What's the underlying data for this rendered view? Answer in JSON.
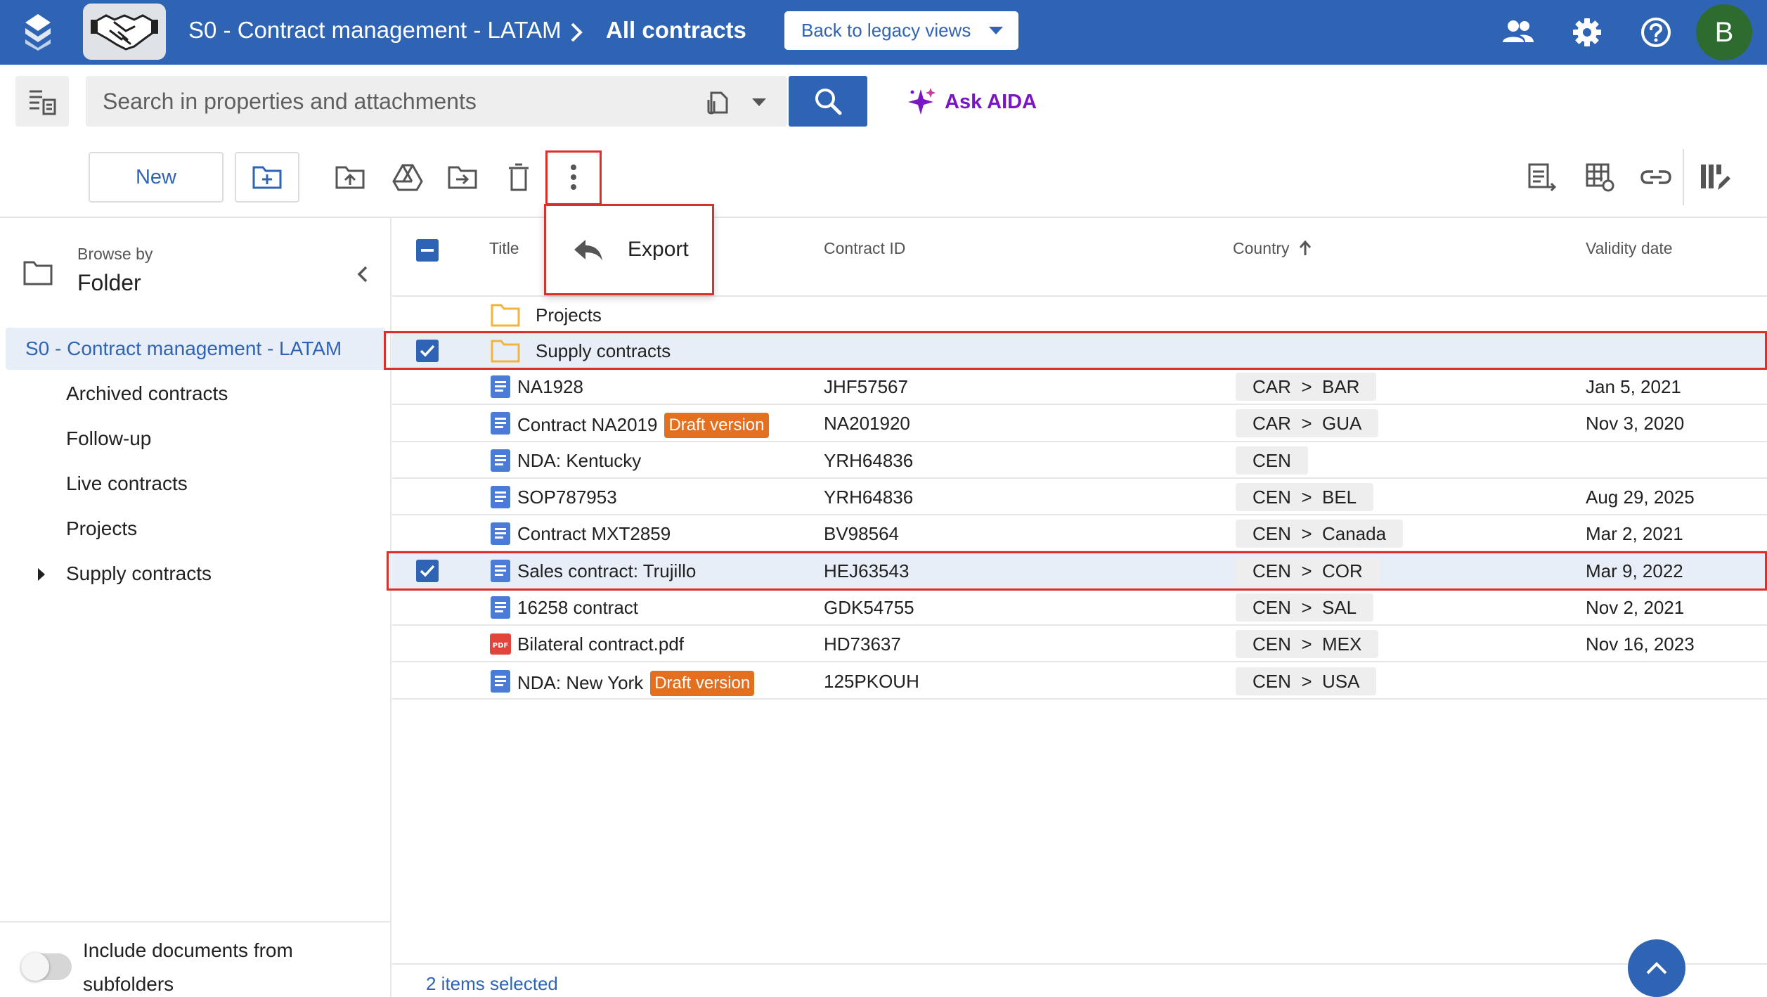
{
  "header": {
    "workspace_title": "S0 - Contract management - LATAM",
    "current_view": "All contracts",
    "legacy_button": "Back to legacy views",
    "avatar_initial": "B",
    "brand_color": "#2f64b4"
  },
  "search": {
    "placeholder": "Search in properties and attachments",
    "ask_aida": "Ask AIDA"
  },
  "toolbar": {
    "new_label": "New",
    "export_label": "Export"
  },
  "sidebar": {
    "browse_by": "Browse by",
    "browse_mode": "Folder",
    "root": "S0 - Contract management - LATAM",
    "items": [
      {
        "label": "Archived contracts"
      },
      {
        "label": "Follow-up"
      },
      {
        "label": "Live contracts"
      },
      {
        "label": "Projects"
      },
      {
        "label": "Supply contracts"
      }
    ],
    "include_subfolders": "Include documents from subfolders"
  },
  "grid": {
    "columns": {
      "title": "Title",
      "contract_id": "Contract ID",
      "country": "Country",
      "validity": "Validity date"
    },
    "folders": [
      {
        "title": "Projects",
        "selected": false
      },
      {
        "title": "Supply contracts",
        "selected": true
      }
    ],
    "rows": [
      {
        "title": "NA1928",
        "badge": "",
        "type": "doc",
        "contract_id": "JHF57567",
        "country": "CAR  >  BAR",
        "validity": "Jan 5, 2021",
        "selected": false
      },
      {
        "title": "Contract NA2019",
        "badge": "Draft version",
        "type": "doc",
        "contract_id": "NA201920",
        "country": "CAR  >  GUA",
        "validity": "Nov 3, 2020",
        "selected": false
      },
      {
        "title": "NDA: Kentucky",
        "badge": "",
        "type": "doc",
        "contract_id": "YRH64836",
        "country": "CEN",
        "validity": "",
        "selected": false
      },
      {
        "title": "SOP787953",
        "badge": "",
        "type": "doc",
        "contract_id": "YRH64836",
        "country": "CEN  >  BEL",
        "validity": "Aug 29, 2025",
        "selected": false
      },
      {
        "title": "Contract MXT2859",
        "badge": "",
        "type": "doc",
        "contract_id": "BV98564",
        "country": "CEN  >  Canada",
        "validity": "Mar 2, 2021",
        "selected": false
      },
      {
        "title": "Sales contract: Trujillo",
        "badge": "",
        "type": "doc",
        "contract_id": "HEJ63543",
        "country": "CEN  >  COR",
        "validity": "Mar 9, 2022",
        "selected": true
      },
      {
        "title": "16258 contract",
        "badge": "",
        "type": "doc",
        "contract_id": "GDK54755",
        "country": "CEN  >  SAL",
        "validity": "Nov 2, 2021",
        "selected": false
      },
      {
        "title": "Bilateral contract.pdf",
        "badge": "",
        "type": "pdf",
        "contract_id": "HD73637",
        "country": "CEN  >  MEX",
        "validity": "Nov 16, 2023",
        "selected": false
      },
      {
        "title": "NDA: New York",
        "badge": "Draft version",
        "type": "doc",
        "contract_id": "125PKOUH",
        "country": "CEN  >  USA",
        "validity": "",
        "selected": false
      }
    ],
    "footer_status": "2 items selected"
  }
}
